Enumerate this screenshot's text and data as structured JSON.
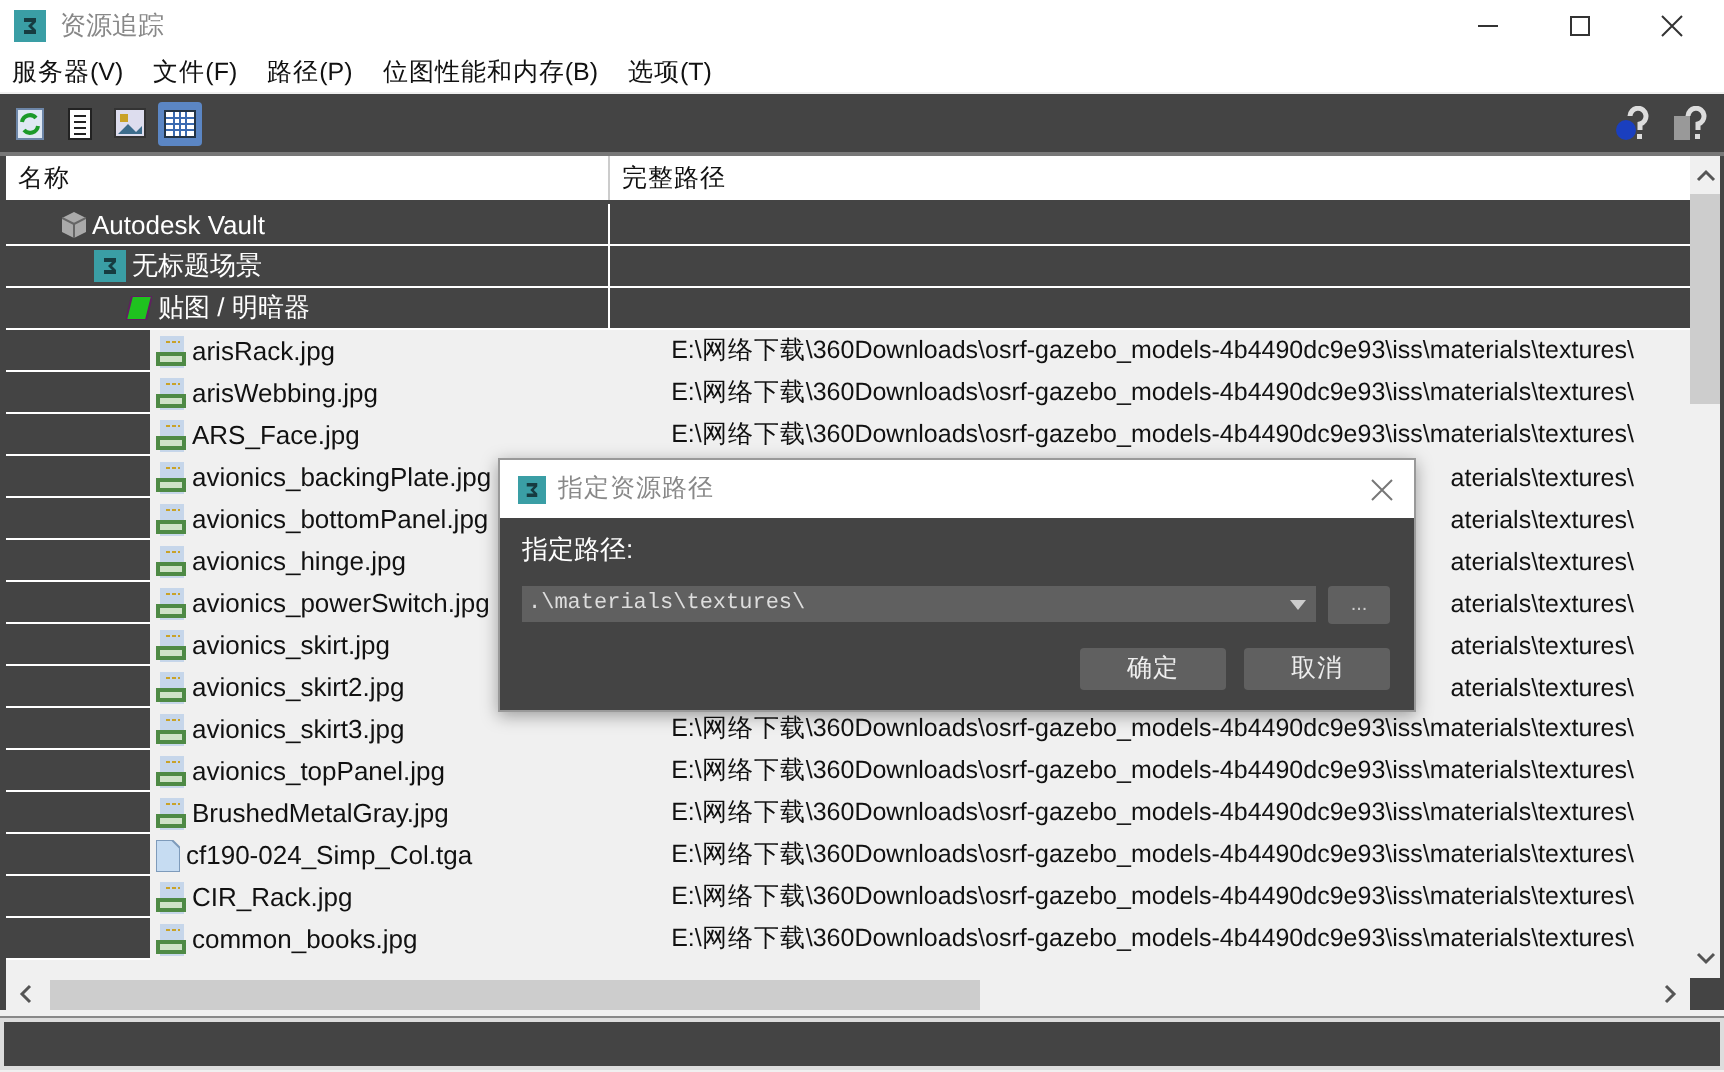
{
  "window": {
    "title": "资源追踪"
  },
  "menu": [
    "服务器(V)",
    "文件(F)",
    "路径(P)",
    "位图性能和内存(B)",
    "选项(T)"
  ],
  "toolbar": [
    {
      "kind": "refresh",
      "selected": false
    },
    {
      "kind": "list",
      "selected": false
    },
    {
      "kind": "image",
      "selected": false
    },
    {
      "kind": "grid",
      "selected": true
    }
  ],
  "table": {
    "columns": [
      "名称",
      "完整路径"
    ],
    "tree": [
      {
        "name": "Autodesk Vault",
        "kind": "vault",
        "children": [
          {
            "name": "无标题场景",
            "kind": "scene",
            "children": [
              {
                "name": "贴图 / 明暗器",
                "kind": "maps",
                "children": [
                  {
                    "name": "arisRack.jpg",
                    "kind": "jpg",
                    "path": "E:\\网络下载\\360Downloads\\osrf-gazebo_models-4b4490dc9e93\\iss\\materials\\textures\\"
                  },
                  {
                    "name": "arisWebbing.jpg",
                    "kind": "jpg",
                    "path": "E:\\网络下载\\360Downloads\\osrf-gazebo_models-4b4490dc9e93\\iss\\materials\\textures\\"
                  },
                  {
                    "name": "ARS_Face.jpg",
                    "kind": "jpg",
                    "path": "E:\\网络下载\\360Downloads\\osrf-gazebo_models-4b4490dc9e93\\iss\\materials\\textures\\"
                  },
                  {
                    "name": "avionics_backingPlate.jpg",
                    "kind": "jpg",
                    "path": "aterials\\textures\\"
                  },
                  {
                    "name": "avionics_bottomPanel.jpg",
                    "kind": "jpg",
                    "path": "aterials\\textures\\"
                  },
                  {
                    "name": "avionics_hinge.jpg",
                    "kind": "jpg",
                    "path": "aterials\\textures\\"
                  },
                  {
                    "name": "avionics_powerSwitch.jpg",
                    "kind": "jpg",
                    "path": "aterials\\textures\\"
                  },
                  {
                    "name": "avionics_skirt.jpg",
                    "kind": "jpg",
                    "path": "aterials\\textures\\"
                  },
                  {
                    "name": "avionics_skirt2.jpg",
                    "kind": "jpg",
                    "path": "aterials\\textures\\"
                  },
                  {
                    "name": "avionics_skirt3.jpg",
                    "kind": "jpg",
                    "path": "E:\\网络下载\\360Downloads\\osrf-gazebo_models-4b4490dc9e93\\iss\\materials\\textures\\"
                  },
                  {
                    "name": "avionics_topPanel.jpg",
                    "kind": "jpg",
                    "path": "E:\\网络下载\\360Downloads\\osrf-gazebo_models-4b4490dc9e93\\iss\\materials\\textures\\"
                  },
                  {
                    "name": "BrushedMetalGray.jpg",
                    "kind": "jpg",
                    "path": "E:\\网络下载\\360Downloads\\osrf-gazebo_models-4b4490dc9e93\\iss\\materials\\textures\\"
                  },
                  {
                    "name": "cf190-024_Simp_Col.tga",
                    "kind": "tga",
                    "path": "E:\\网络下载\\360Downloads\\osrf-gazebo_models-4b4490dc9e93\\iss\\materials\\textures\\"
                  },
                  {
                    "name": "CIR_Rack.jpg",
                    "kind": "jpg",
                    "path": "E:\\网络下载\\360Downloads\\osrf-gazebo_models-4b4490dc9e93\\iss\\materials\\textures\\"
                  },
                  {
                    "name": "common_books.jpg",
                    "kind": "jpg",
                    "path": "E:\\网络下载\\360Downloads\\osrf-gazebo_models-4b4490dc9e93\\iss\\materials\\textures\\"
                  }
                ]
              }
            ]
          }
        ]
      }
    ]
  },
  "dialog": {
    "title": "指定资源路径",
    "label": "指定路径:",
    "value": ".\\materials\\textures\\",
    "browse": "...",
    "buttons": [
      "确定",
      "取消"
    ]
  }
}
